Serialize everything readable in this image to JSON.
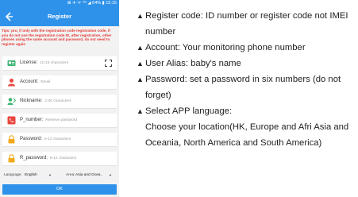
{
  "status_bar": {
    "text": "⊠ ✈ ᯤ ⁴ᴳ ◢ 64% ▮ 15:15"
  },
  "app": {
    "title": "Register",
    "tip": "Tips: pro, if only with the registration code registration code, if you do not use the registration code ID, after registration, other phones using the same account and password, do not need to register again",
    "fields": [
      {
        "label": "License:",
        "placeholder": "10,15 characters",
        "icon": "id-card-icon",
        "color": "#3cb371"
      },
      {
        "label": "Account:",
        "placeholder": "Email",
        "icon": "person-icon",
        "color": "#e8453c"
      },
      {
        "label": "Nickname:",
        "placeholder": "2-30 characters",
        "icon": "nickname-icon",
        "color": "#3cb371"
      },
      {
        "label": "P_number:",
        "placeholder": "Retrieve password",
        "icon": "phone-icon",
        "color": "#e8453c"
      },
      {
        "label": "Password:",
        "placeholder": "6-12 characters",
        "icon": "lock-icon",
        "color": "#f2a91f"
      },
      {
        "label": "R_password:",
        "placeholder": "6-12 characters",
        "icon": "lock-icon",
        "color": "#f2a91f"
      }
    ],
    "language_label": "Language:",
    "language_value": "English",
    "area_label": "Area:",
    "area_value": "Asia and Ocea..",
    "ok_label": "OK",
    "accent_color": "#2f92ea"
  },
  "notes": [
    "Register code: ID number or register code not IMEI number",
    "Account: Your monitoring phone number",
    "User Alias: baby's name",
    "Password: set a password in six numbers (do not forget)",
    "Select APP language:",
    "Choose your location(HK, Europe and Afri Asia and Oceania, North America and South America)"
  ]
}
